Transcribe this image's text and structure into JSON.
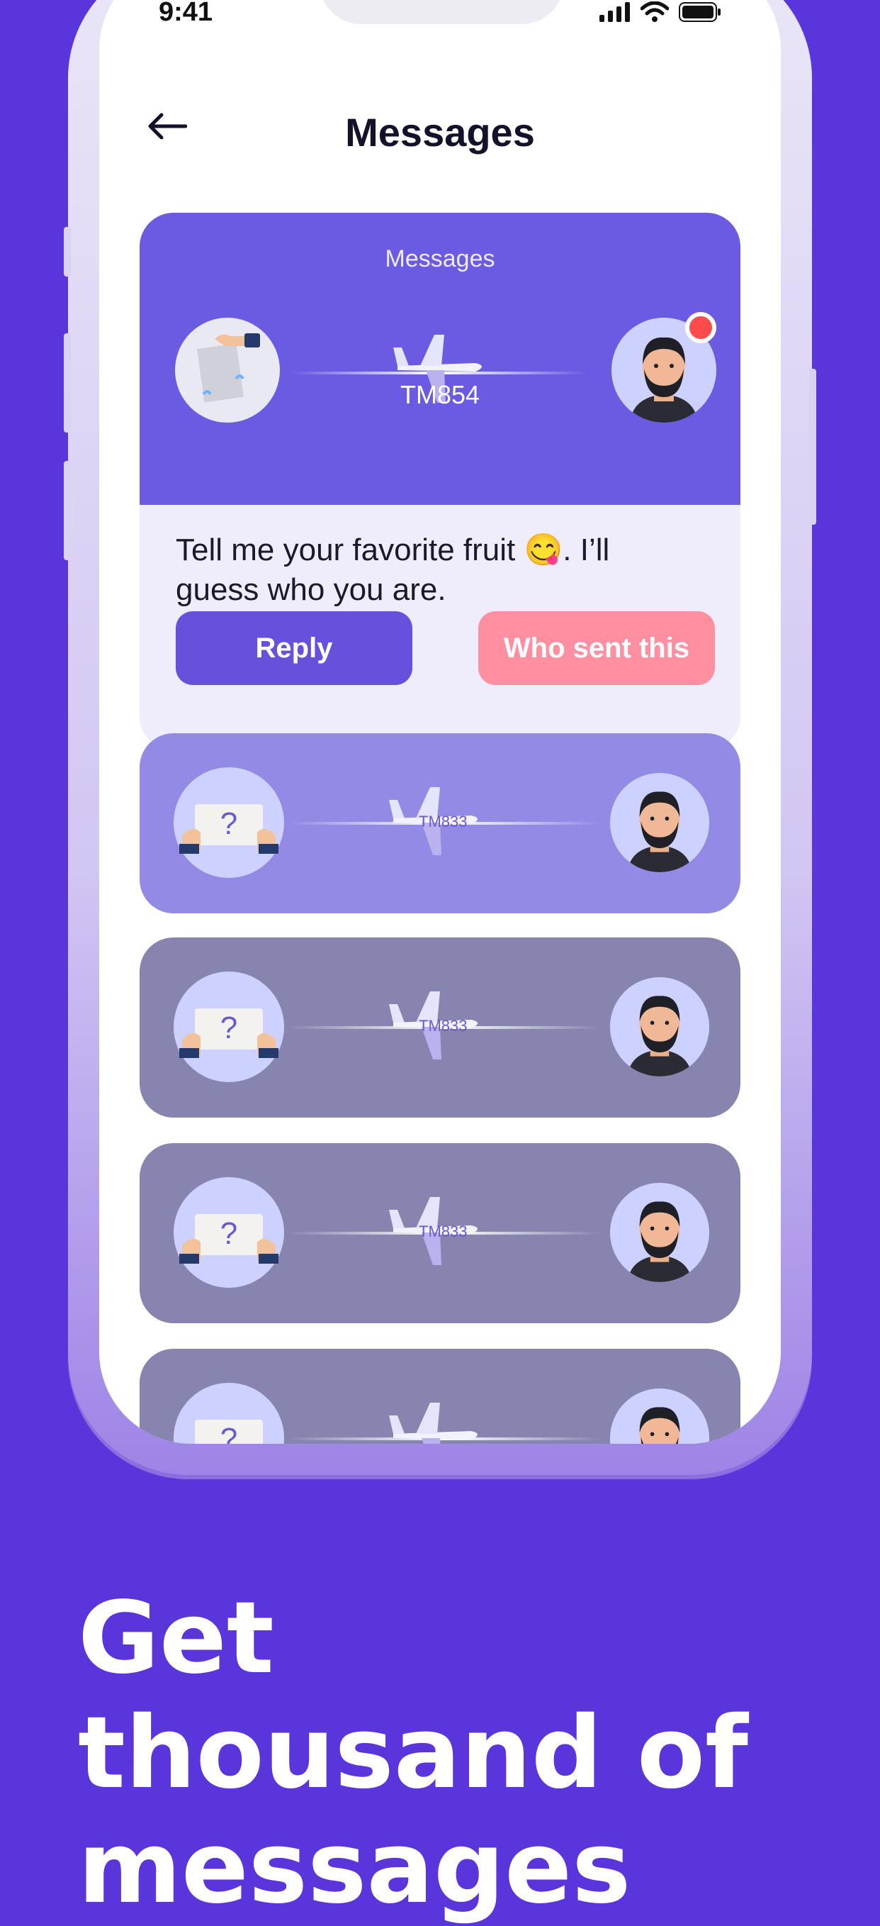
{
  "status_bar": {
    "time": "9:41"
  },
  "header": {
    "title": "Messages"
  },
  "featured_message": {
    "card_label": "Messages",
    "flight_code": "TM854",
    "text": "Tell me your favorite fruit 😋. I’ll guess who you are.",
    "reply_label": "Reply",
    "who_sent_label": "Who sent this"
  },
  "message_list": [
    {
      "flight_code": "TM833",
      "background": "#938ae6"
    },
    {
      "flight_code": "TM833",
      "background": "#8884b0"
    },
    {
      "flight_code": "TM833",
      "background": "#8884b0"
    },
    {
      "flight_code": "",
      "background": "#8884b0"
    }
  ],
  "caption": "Get thousand of messages",
  "colors": {
    "background": "#5b35dc",
    "primary": "#6650dc",
    "accent_pink": "#ff8fa1",
    "notification": "#ff4b4b"
  }
}
